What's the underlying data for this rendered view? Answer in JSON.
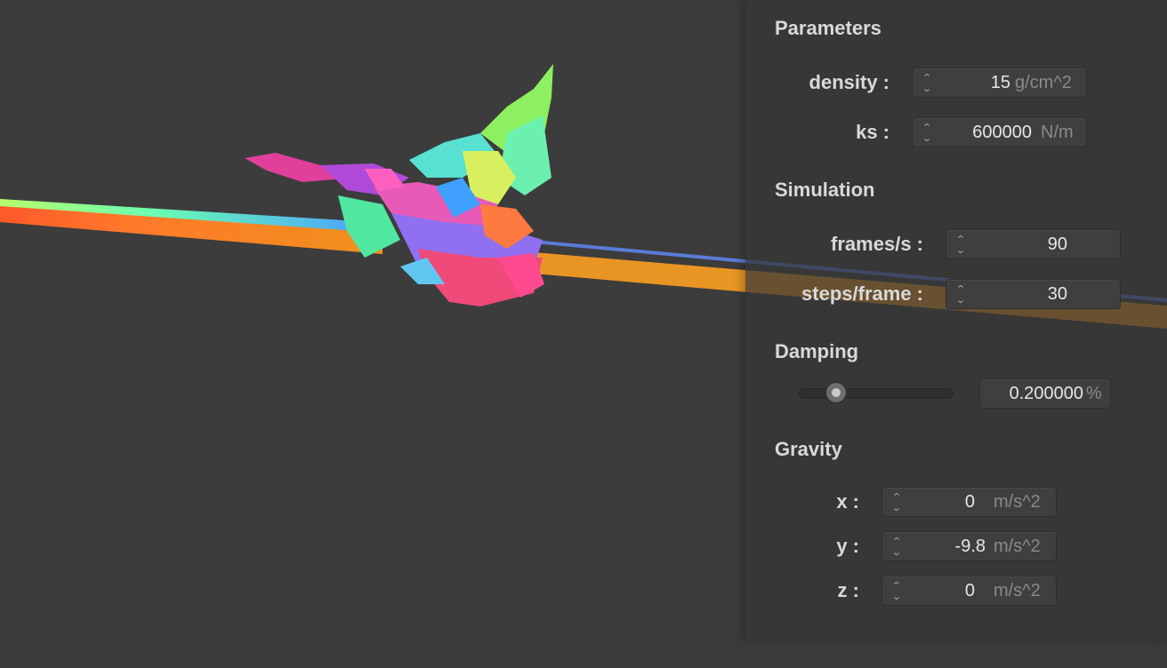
{
  "colors": {
    "background": "#3c3c3c",
    "panel": "#363636",
    "text": "#d9d9d9",
    "unit_text": "#8a8a8a"
  },
  "panel": {
    "parameters": {
      "title": "Parameters",
      "density": {
        "label": "density :",
        "value": "15",
        "unit": "g/cm^2"
      },
      "ks": {
        "label": "ks :",
        "value": "600000",
        "unit": "N/m"
      }
    },
    "simulation": {
      "title": "Simulation",
      "frames": {
        "label": "frames/s :",
        "value": "90"
      },
      "steps": {
        "label": "steps/frame :",
        "value": "30"
      }
    },
    "damping": {
      "title": "Damping",
      "slider_level_percent": 20,
      "value": "0.200000",
      "unit": "%"
    },
    "gravity": {
      "title": "Gravity",
      "x": {
        "label": "x :",
        "value": "0",
        "unit": "m/s^2"
      },
      "y": {
        "label": "y :",
        "value": "-9.8",
        "unit": "m/s^2"
      },
      "z": {
        "label": "z :",
        "value": "0",
        "unit": "m/s^2"
      }
    }
  },
  "viewport": {
    "content": "cloth-simulation-mesh"
  }
}
